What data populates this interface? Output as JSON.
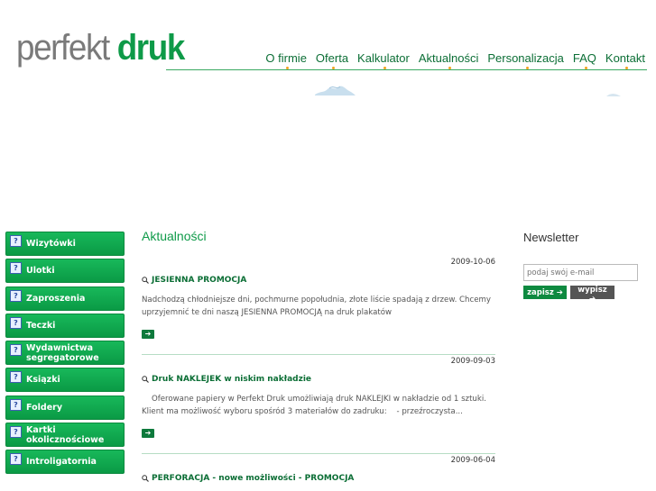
{
  "logo": {
    "part1": "perfekt ",
    "part2": "druk"
  },
  "nav": [
    "O firmie",
    "Oferta",
    "Kalkulator",
    "Aktualności",
    "Personalizacja",
    "FAQ",
    "Kontakt"
  ],
  "sidebar": {
    "icon": "?",
    "items": [
      "Wizytówki",
      "Ulotki",
      "Zaproszenia",
      "Teczki",
      "Wydawnictwa segregatorowe",
      "Ksiązki",
      "Foldery",
      "Kartki okolicznościowe",
      "Introligatornia"
    ]
  },
  "main": {
    "heading": "Aktualności",
    "news": [
      {
        "date": "2009-10-06",
        "title": "JESIENNA PROMOCJA",
        "body": "Nadchodzą chłodniejsze dni, pochmurne popołudnia, złote liście spadają z drzew. Chcemy uprzyjemnić te dni naszą JESIENNA PROMOCJĄ na druk plakatów",
        "more": "➔"
      },
      {
        "date": "2009-09-03",
        "title": "Druk NAKLEJEK w niskim nakładzie",
        "body": "    Oferowane papiery w Perfekt Druk umożliwiają druk NAKLEJKI w nakładzie od 1 sztuki. Klient ma możliwość wyboru spośród 3 materiałów do zadruku:    - przeźroczysta...",
        "more": "➔"
      },
      {
        "date": "2009-06-04",
        "title": "PERFORACJA - nowe możliwości - PROMOCJA",
        "body": "",
        "more": ""
      }
    ]
  },
  "newsletter": {
    "title": "Newsletter",
    "placeholder": "podaj swój e-mail",
    "save": "zapisz ➔",
    "unsubscribe": "wypisz ➔"
  }
}
